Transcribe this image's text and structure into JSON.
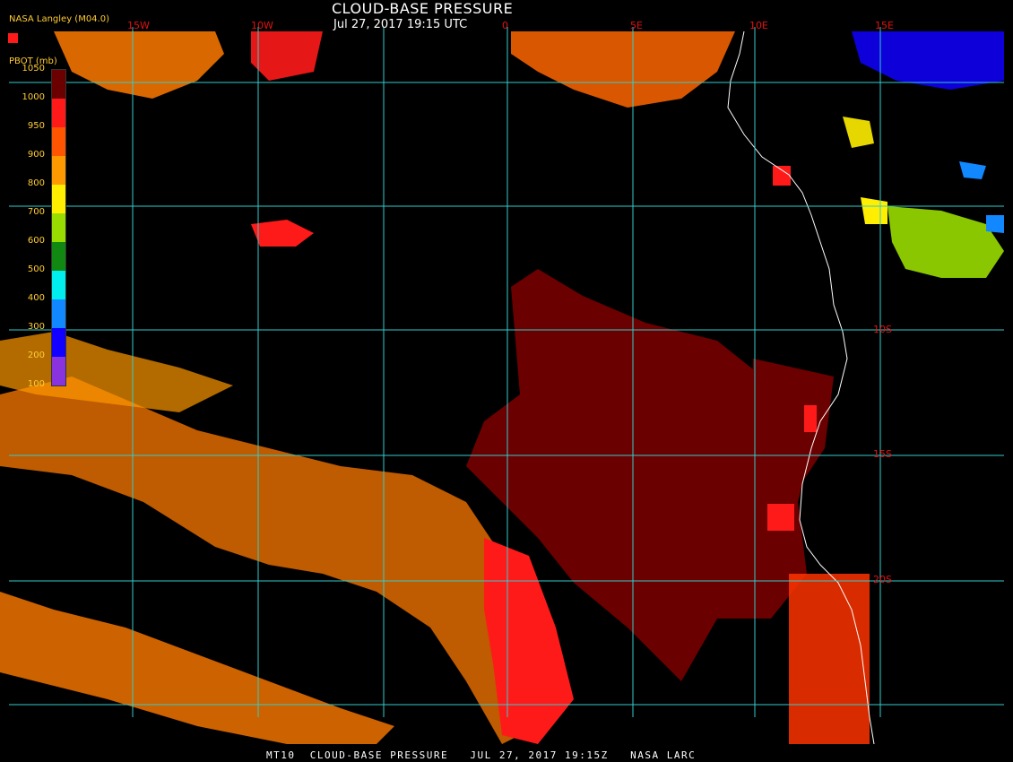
{
  "header": {
    "title": "CLOUD-BASE PRESSURE",
    "datetime": "Jul 27, 2017 19:15 UTC",
    "producer": "NASA Langley (M04.0)"
  },
  "footer": {
    "caption": "MT10  CLOUD-BASE PRESSURE   JUL 27, 2017 19:15Z   NASA LARC"
  },
  "longitude_labels": [
    "15W",
    "10W",
    "0",
    "5E",
    "10E",
    "15E"
  ],
  "latitude_labels": [
    "10S",
    "15S",
    "20S"
  ],
  "legend": {
    "title": "PBOT (mb)",
    "ticks": [
      "1050",
      "1000",
      "950",
      "900",
      "800",
      "700",
      "600",
      "500",
      "400",
      "300",
      "200",
      "100"
    ],
    "colors": [
      "#6b0000",
      "#ff1a1a",
      "#ff5500",
      "#ff9900",
      "#ffee00",
      "#99dd00",
      "#118811",
      "#00eeee",
      "#1188ff",
      "#1100ff",
      "#8833dd"
    ]
  },
  "colors": {
    "grid": "#33cccc",
    "coast": "#ffffff",
    "background": "#000000",
    "label_red": "#e51111",
    "label_orange": "#ffcc33"
  }
}
